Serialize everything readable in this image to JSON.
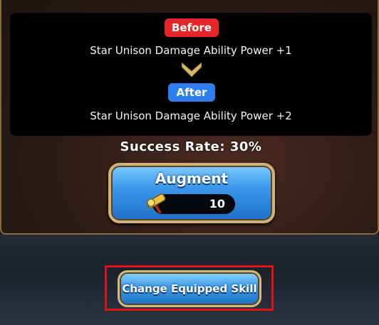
{
  "upgrade": {
    "before_label": "Before",
    "before_text": "Star Unison Damage Ability Power +1",
    "after_label": "After",
    "after_text": "Star Unison Damage Ability Power +2",
    "success_rate": "Success Rate: 30%"
  },
  "augment": {
    "button_label": "Augment",
    "cost_value": "10",
    "cost_icon": "hammer-icon"
  },
  "footer": {
    "change_skill_label": "Change Equipped Skill"
  },
  "colors": {
    "before_badge": "#e8262a",
    "after_badge": "#2f7ef0",
    "button_blue": "#3b98ea",
    "button_border_gold": "#cfb37a",
    "highlight_red": "#e01216"
  }
}
